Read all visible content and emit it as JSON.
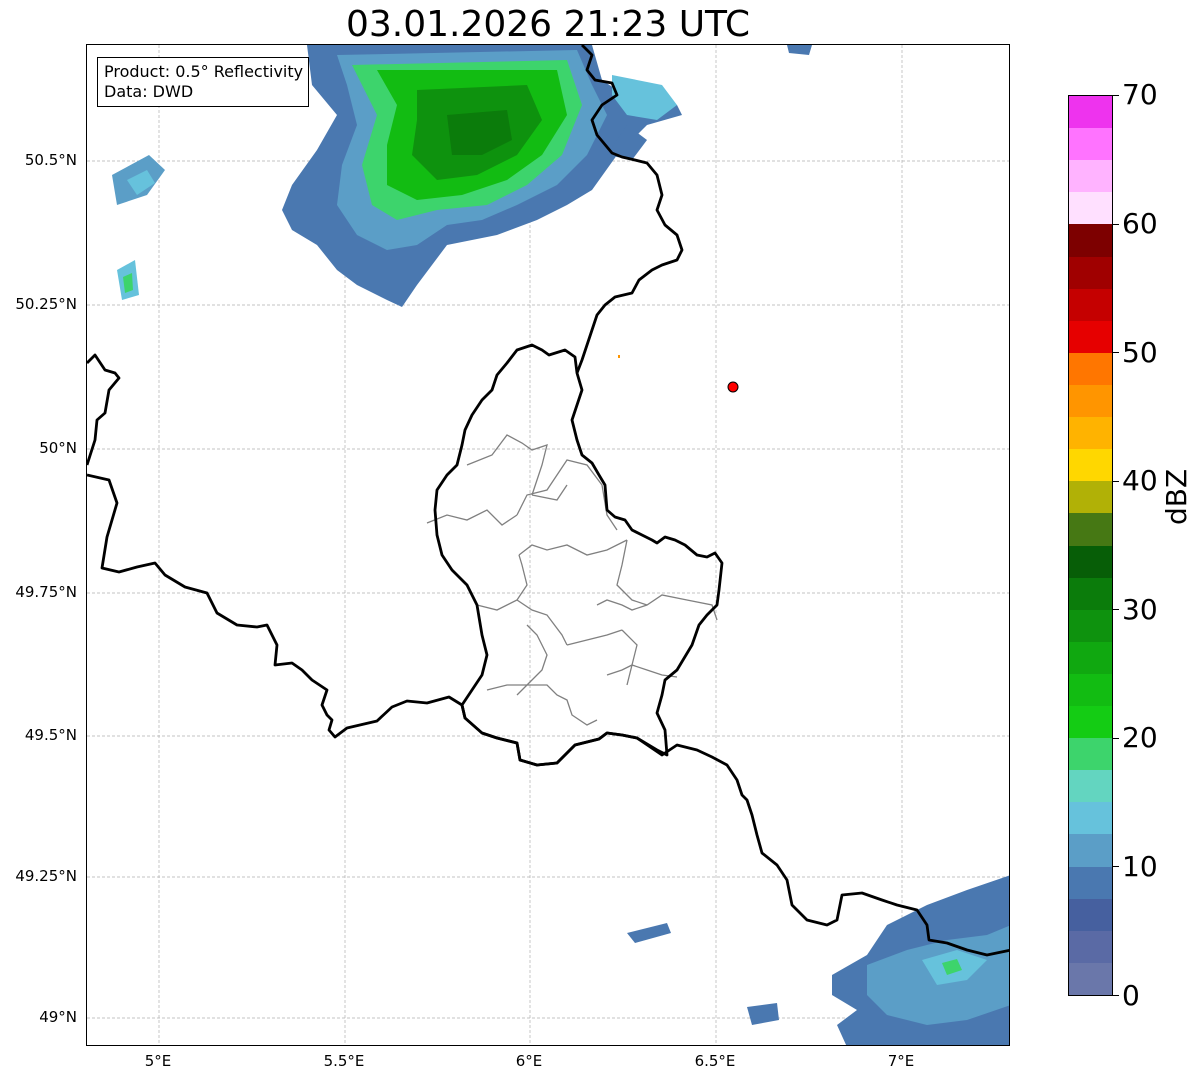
{
  "title": "03.01.2026 21:23 UTC",
  "info": {
    "product": "Product: 0.5° Reflectivity",
    "data": "Data: DWD"
  },
  "axes": {
    "lat_labels": [
      "50.5°N",
      "50.25°N",
      "50°N",
      "49.75°N",
      "49.5°N",
      "49.25°N",
      "49°N"
    ],
    "lon_labels": [
      "5°E",
      "5.5°E",
      "6°E",
      "6.5°E",
      "7°E"
    ]
  },
  "colorbar": {
    "unit": "dBZ",
    "tick_labels": [
      "0",
      "10",
      "20",
      "30",
      "40",
      "50",
      "60",
      "70"
    ],
    "colors": [
      "#6a77aa",
      "#5a6aa5",
      "#46609f",
      "#4a78b0",
      "#5b9ec7",
      "#66c2dc",
      "#63d5c0",
      "#3dd46c",
      "#14cc14",
      "#12bc12",
      "#10a810",
      "#0e920e",
      "#0b7c0b",
      "#075e07",
      "#467814",
      "#b1b106",
      "#ffd700",
      "#ffb300",
      "#ff9500",
      "#ff7600",
      "#e60000",
      "#c50000",
      "#a00000",
      "#7d0000",
      "#ffe0ff",
      "#ffb3ff",
      "#ff73ff",
      "#ee33ee"
    ]
  },
  "map_style": {
    "country_border_color": "#000000",
    "canton_border_color": "#808080",
    "grid_color": "#b0b0b0",
    "marker_color": "#ff0000"
  },
  "marker": {
    "name": "radar-site-marker",
    "lon": 6.55,
    "lat": 50.11
  }
}
